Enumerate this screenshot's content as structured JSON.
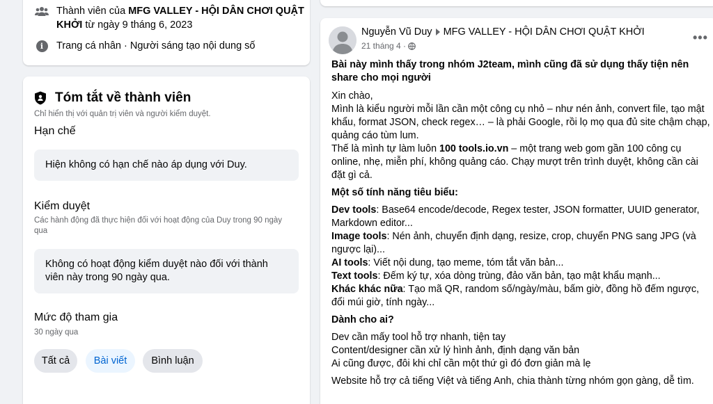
{
  "about": {
    "member_prefix": "Thành viên của ",
    "group_name": "MFG VALLEY - HỘI DÂN CHƠI QUẬT KHỞI",
    "member_suffix": " từ ngày 9 tháng 6, 2023",
    "profile_label": "Trang cá nhân",
    "profile_suffix": " · Người sáng tạo nội dung số"
  },
  "summary": {
    "title": "Tóm tắt về thành viên",
    "subtitle": "Chỉ hiển thị với quản trị viên và người kiểm duyệt.",
    "restrictions": {
      "heading": "Hạn chế",
      "text": "Hiện không có hạn chế nào áp dụng với Duy."
    },
    "moderation": {
      "heading": "Kiểm duyệt",
      "description": "Các hành động đã thực hiện đối với hoạt động của Duy trong 90 ngày qua",
      "text": "Không có hoạt động kiểm duyệt nào đối với thành viên này trong 90 ngày qua."
    },
    "engagement": {
      "heading": "Mức độ tham gia",
      "description": "30 ngày qua",
      "tabs": [
        "Tất cả",
        "Bài viết",
        "Bình luận"
      ],
      "active_tab": "Bài viết"
    }
  },
  "post": {
    "author": "Nguyễn Vũ Duy",
    "group": "MFG VALLEY - HỘI DÂN CHƠI QUẬT KHỞI",
    "date": "21 tháng 4",
    "meta_sep": " · ",
    "more_label": "•••",
    "headline": "Bài này mình thấy trong nhóm J2team, mình cũng đã sử dụng thấy tiện nên share cho mọi người",
    "greeting": "Xin chào,",
    "intro": "Mình là kiểu người mỗi lần cần một công cụ nhỏ – như nén ảnh, convert file, tạo mật khẩu, format JSON, check regex… – là phải Google, rồi lọ mọ qua đủ site chậm chạp, quảng cáo tùm lum.",
    "intro2_pre": "Thế là mình tự làm luôn ",
    "intro2_bold": "100 tools.io.vn",
    "intro2_post": " – một trang web gom gần 100 công cụ online, nhẹ, miễn phí, không quảng cáo. Chạy mượt trên trình duyệt, không cần cài đặt gì cả.",
    "features_heading": "Một số tính năng tiêu biểu:",
    "features": [
      {
        "label": "Dev tools",
        "text": ": Base64 encode/decode, Regex tester, JSON formatter, UUID generator, Markdown editor..."
      },
      {
        "label": "Image tools",
        "text": ": Nén ảnh, chuyển định dạng, resize, crop, chuyển PNG sang JPG (và ngược lại)..."
      },
      {
        "label": "AI tools",
        "text": ": Viết nội dung, tạo meme, tóm tắt văn bản..."
      },
      {
        "label": "Text tools",
        "text": ": Đếm ký tự, xóa dòng trùng, đảo văn bản, tạo mật khẩu mạnh..."
      },
      {
        "label": "Khác khác nữa",
        "text": ": Tạo mã QR, random số/ngày/màu, bấm giờ, đồng hồ đếm ngược, đổi múi giờ, tính ngày..."
      }
    ],
    "audience_heading": "Dành cho ai?",
    "audience": [
      "Dev cần mấy tool hỗ trợ nhanh, tiện tay",
      "Content/designer cần xử lý hình ảnh, định dạng văn bản",
      "Ai cũng được, đôi khi chỉ cần một thứ gì đó đơn giản mà lẹ"
    ],
    "closing": "Website hỗ trợ cả tiếng Việt và tiếng Anh, chia thành từng nhóm gọn gàng, dễ tìm."
  },
  "colors": {
    "background": "#f0f2f5",
    "card": "#ffffff",
    "secondary_text": "#65676b",
    "active_tab_bg": "#ebf5ff",
    "active_tab_text": "#0064d1",
    "pill_bg": "#e4e6eb"
  }
}
